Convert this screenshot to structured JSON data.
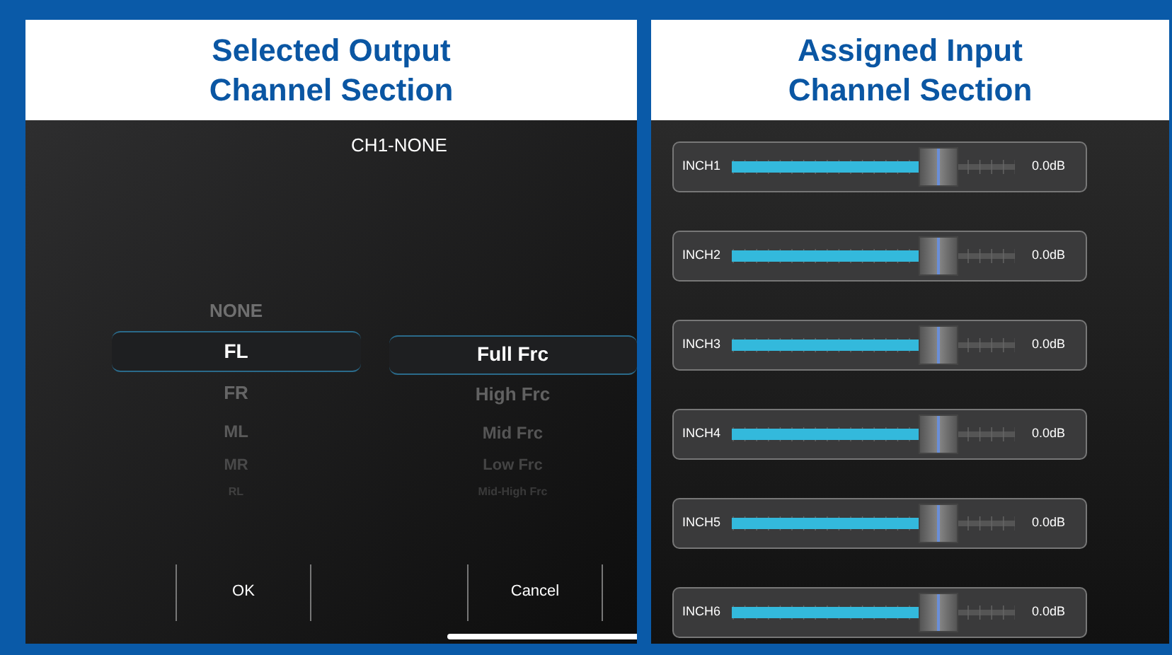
{
  "output_section": {
    "title": "Selected Output Channel Section",
    "channel_title": "CH1-NONE",
    "picker_columns": [
      {
        "items": [
          {
            "label": "NONE",
            "selected": false
          },
          {
            "label": "FL",
            "selected": true
          },
          {
            "label": "FR",
            "selected": false
          },
          {
            "label": "ML",
            "selected": false
          },
          {
            "label": "MR",
            "selected": false
          },
          {
            "label": "RL",
            "selected": false
          }
        ]
      },
      {
        "items": [
          {
            "label": "Full Frc",
            "selected": true
          },
          {
            "label": "High Frc",
            "selected": false
          },
          {
            "label": "Mid Frc",
            "selected": false
          },
          {
            "label": "Low Frc",
            "selected": false
          },
          {
            "label": "Mid-High Frc",
            "selected": false
          }
        ]
      }
    ],
    "buttons": [
      "OK",
      "Cancel"
    ]
  },
  "input_section": {
    "title": "Assigned Input Channel Section",
    "channels": [
      {
        "name": "INCH1",
        "level": 0.67,
        "reading": "0.0dB"
      },
      {
        "name": "INCH2",
        "level": 0.67,
        "reading": "0.0dB"
      },
      {
        "name": "INCH3",
        "level": 0.67,
        "reading": "0.0dB"
      },
      {
        "name": "INCH4",
        "level": 0.67,
        "reading": "0.0dB"
      },
      {
        "name": "INCH5",
        "level": 0.67,
        "reading": "0.0dB"
      },
      {
        "name": "INCH6",
        "level": 0.67,
        "reading": "0.0dB"
      }
    ]
  }
}
